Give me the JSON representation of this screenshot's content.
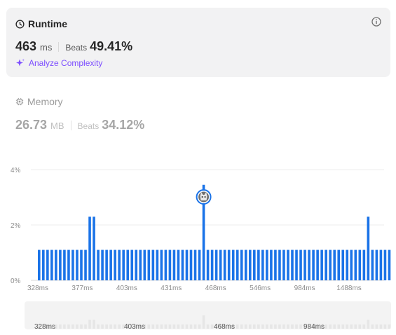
{
  "runtime": {
    "title": "Runtime",
    "value": "463",
    "unit": "ms",
    "beats_label": "Beats",
    "beats_value": "49.41%",
    "analyze_label": "Analyze Complexity",
    "info_icon": "info-icon",
    "clock_icon": "clock-icon",
    "sparkle_icon": "sparkle-icon"
  },
  "memory": {
    "title": "Memory",
    "value": "26.73",
    "unit": "MB",
    "beats_label": "Beats",
    "beats_value": "34.12%",
    "icon": "chip-icon"
  },
  "colors": {
    "accent": "#7c4dff",
    "bar": "#1a73e8",
    "bar_light": "#e6e6e6",
    "card_bg": "#f2f2f3"
  },
  "chart_data": {
    "type": "bar",
    "ylim": [
      0,
      4
    ],
    "yticks": [
      "0%",
      "2%",
      "4%"
    ],
    "x_tick_labels": [
      "328ms",
      "377ms",
      "403ms",
      "431ms",
      "468ms",
      "546ms",
      "984ms",
      "1488ms"
    ],
    "highlight_index": 39,
    "values": [
      1.1,
      1.1,
      1.1,
      1.1,
      1.1,
      1.1,
      1.1,
      1.1,
      1.1,
      1.1,
      1.1,
      1.1,
      2.3,
      2.3,
      1.1,
      1.1,
      1.1,
      1.1,
      1.1,
      1.1,
      1.1,
      1.1,
      1.1,
      1.1,
      1.1,
      1.1,
      1.1,
      1.1,
      1.1,
      1.1,
      1.1,
      1.1,
      1.1,
      1.1,
      1.1,
      1.1,
      1.1,
      1.1,
      1.1,
      3.45,
      1.1,
      1.1,
      1.1,
      1.1,
      1.1,
      1.1,
      1.1,
      1.1,
      1.1,
      1.1,
      1.1,
      1.1,
      1.1,
      1.1,
      1.1,
      1.1,
      1.1,
      1.1,
      1.1,
      1.1,
      1.1,
      1.1,
      1.1,
      1.1,
      1.1,
      1.1,
      1.1,
      1.1,
      1.1,
      1.1,
      1.1,
      1.1,
      1.1,
      1.1,
      1.1,
      1.1,
      1.1,
      1.1,
      2.3,
      1.1,
      1.1,
      1.1,
      1.1,
      1.1
    ],
    "grid": true,
    "overview": {
      "x_tick_labels": [
        "328ms",
        "403ms",
        "468ms",
        "984ms"
      ]
    }
  }
}
